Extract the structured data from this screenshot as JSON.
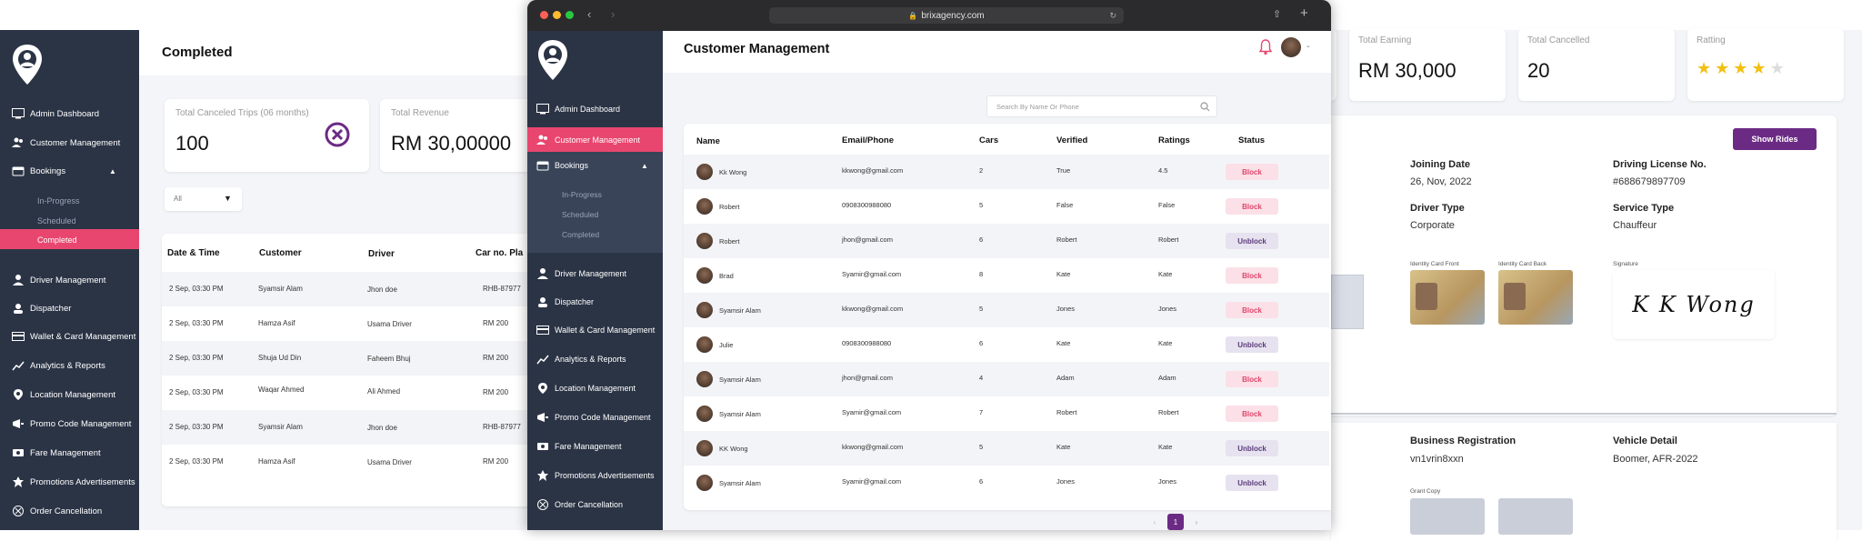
{
  "left_window": {
    "sidebar": {
      "items": [
        {
          "label": "Admin Dashboard",
          "icon": "dashboard-icon"
        },
        {
          "label": "Customer Management",
          "icon": "users-icon"
        },
        {
          "label": "Bookings",
          "icon": "bookings-icon"
        },
        {
          "label": "Driver Management",
          "icon": "driver-icon"
        },
        {
          "label": "Dispatcher",
          "icon": "dispatcher-icon"
        },
        {
          "label": "Wallet & Card Management",
          "icon": "wallet-icon"
        },
        {
          "label": "Analytics & Reports",
          "icon": "analytics-icon"
        },
        {
          "label": "Location Management",
          "icon": "location-icon"
        },
        {
          "label": "Promo Code Management",
          "icon": "promo-icon"
        },
        {
          "label": "Fare Management",
          "icon": "fare-icon"
        },
        {
          "label": "Promotions Advertisements",
          "icon": "promotions-icon"
        },
        {
          "label": "Order Cancellation",
          "icon": "cancel-order-icon"
        }
      ],
      "bookings_sub": [
        "In-Progress",
        "Scheduled",
        "Completed"
      ]
    },
    "title": "Completed",
    "stats": [
      {
        "label": "Total Canceled Trips (06 months)",
        "value": "100"
      },
      {
        "label": "Total Revenue",
        "value": "RM 30,00000"
      }
    ],
    "filter_value": "All",
    "table": {
      "headers": [
        "Date & Time",
        "Customer",
        "Driver",
        "Car no. Pla"
      ],
      "rows": [
        [
          "2 Sep, 03:30 PM",
          "Syamsir Alam",
          "Jhon doe",
          "RHB-87977"
        ],
        [
          "2 Sep, 03:30 PM",
          "Hamza Asif",
          "Usama Driver",
          "RM 200"
        ],
        [
          "2 Sep, 03:30 PM",
          "Shuja Ud Din",
          "Faheem Bhuj",
          "RM 200"
        ],
        [
          "2 Sep, 03:30 PM",
          "Waqar Ahmed",
          "Ali Ahmed",
          "RM 200"
        ],
        [
          "2 Sep, 03:30 PM",
          "Syamsir Alam",
          "Jhon doe",
          "RHB-87977"
        ],
        [
          "2 Sep, 03:30 PM",
          "Hamza Asif",
          "Usama Driver",
          "RM 200"
        ]
      ]
    }
  },
  "browser": {
    "url": "brixagency.com",
    "sidebar": {
      "items": [
        {
          "label": "Admin Dashboard",
          "icon": "dashboard-icon"
        },
        {
          "label": "Customer Management",
          "icon": "users-icon"
        },
        {
          "label": "Bookings",
          "icon": "bookings-icon"
        },
        {
          "label": "Driver Management",
          "icon": "driver-icon"
        },
        {
          "label": "Dispatcher",
          "icon": "dispatcher-icon"
        },
        {
          "label": "Wallet & Card Management",
          "icon": "wallet-icon"
        },
        {
          "label": "Analytics & Reports",
          "icon": "analytics-icon"
        },
        {
          "label": "Location Management",
          "icon": "location-icon"
        },
        {
          "label": "Promo Code Management",
          "icon": "promo-icon"
        },
        {
          "label": "Fare Management",
          "icon": "fare-icon"
        },
        {
          "label": "Promotions Advertisements",
          "icon": "promotions-icon"
        },
        {
          "label": "Order Cancellation",
          "icon": "cancel-order-icon"
        }
      ],
      "bookings_sub": [
        "In-Progress",
        "Scheduled",
        "Completed"
      ]
    },
    "title": "Customer Management",
    "search_placeholder": "Search By Name Or Phone",
    "table": {
      "headers": [
        "Name",
        "Email/Phone",
        "Cars",
        "Verified",
        "Ratings",
        "Status"
      ],
      "rows": [
        {
          "name": "Kk Wong",
          "email": "kkwong@gmail.com",
          "cars": "2",
          "verified": "True",
          "ratings": "4.5",
          "status": "Block"
        },
        {
          "name": "Robert",
          "email": "0908300988080",
          "cars": "5",
          "verified": "False",
          "ratings": "False",
          "status": "Block"
        },
        {
          "name": "Robert",
          "email": "jhon@gmail.com",
          "cars": "6",
          "verified": "Robert",
          "ratings": "Robert",
          "status": "Unblock"
        },
        {
          "name": "Brad",
          "email": "Syamir@gmail.com",
          "cars": "8",
          "verified": "Kate",
          "ratings": "Kate",
          "status": "Block"
        },
        {
          "name": "Syamsir Alam",
          "email": "kkwong@gmail.com",
          "cars": "5",
          "verified": "Jones",
          "ratings": "Jones",
          "status": "Block"
        },
        {
          "name": "Julie",
          "email": "0908300988080",
          "cars": "6",
          "verified": "Kate",
          "ratings": "Kate",
          "status": "Unblock"
        },
        {
          "name": "Syamsir Alam",
          "email": "jhon@gmail.com",
          "cars": "4",
          "verified": "Adam",
          "ratings": "Adam",
          "status": "Block"
        },
        {
          "name": "Syamsir Alam",
          "email": "Syamir@gmail.com",
          "cars": "7",
          "verified": "Robert",
          "ratings": "Robert",
          "status": "Block"
        },
        {
          "name": "KK Wong",
          "email": "kkwong@gmail.com",
          "cars": "5",
          "verified": "Kate",
          "ratings": "Kate",
          "status": "Unblock"
        },
        {
          "name": "Syamsir Alam",
          "email": "Syamir@gmail.com",
          "cars": "6",
          "verified": "Jones",
          "ratings": "Jones",
          "status": "Unblock"
        }
      ]
    },
    "pagination": {
      "current": "1"
    }
  },
  "right_window": {
    "stats": [
      {
        "label": "Total Earning",
        "value": "RM 30,000"
      },
      {
        "label": "Total Cancelled",
        "value": "20"
      },
      {
        "label": "Ratting",
        "value": 4,
        "max": 5
      }
    ],
    "show_rides_label": "Show Rides",
    "info": [
      {
        "label": "Joining Date",
        "value": "26, Nov, 2022"
      },
      {
        "label": "Driving License No.",
        "value": "#688679897709"
      },
      {
        "label": "Driver Type",
        "value": "Corporate"
      },
      {
        "label": "Service Type",
        "value": "Chauffeur"
      },
      {
        "label": "Business Registration",
        "value": "vn1vrin8xxn"
      },
      {
        "label": "Vehicle Detail",
        "value": "Boomer, AFR-2022"
      }
    ],
    "docs": {
      "id_front": "Identity Card Front",
      "id_back": "Identity Card Back",
      "signature": "Signature",
      "grant_copy": "Grant Copy",
      "signature_text": "K K Wong"
    }
  },
  "colors": {
    "sidebar": "#2b3445",
    "active": "#e8466f",
    "primary": "#6b2a84",
    "star": "#f2c012"
  }
}
